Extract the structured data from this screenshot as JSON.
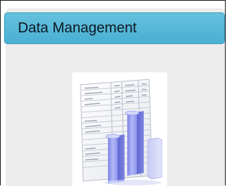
{
  "panel": {
    "title": "Data Management"
  },
  "icon": {
    "name": "data-management-icon",
    "description_hidden": false
  },
  "colors": {
    "header_top": "#66c1de",
    "header_bottom": "#49afd2",
    "panel_bg": "#ececec",
    "bar_fill": "#9aa2f0"
  }
}
